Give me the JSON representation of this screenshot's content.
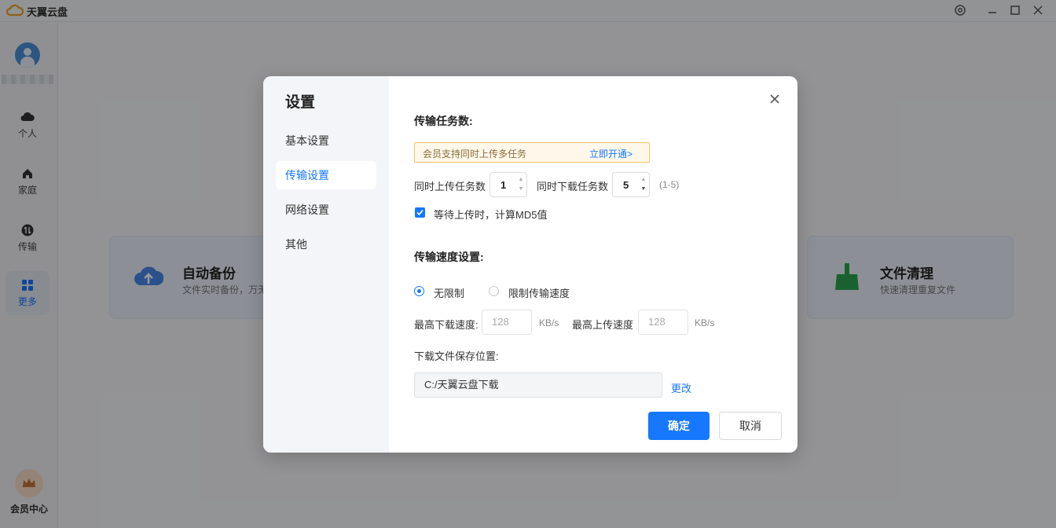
{
  "app": {
    "title": "天翼云盘"
  },
  "sidebar": {
    "items": [
      {
        "label": "个人"
      },
      {
        "label": "家庭"
      },
      {
        "label": "传输"
      },
      {
        "label": "更多"
      }
    ],
    "vip_label": "会员中心"
  },
  "cards": [
    {
      "title": "自动备份",
      "desc": "文件实时备份，万无"
    },
    {
      "title": "文件清理",
      "desc": "快速清理重复文件"
    }
  ],
  "dialog": {
    "title": "设置",
    "menu": [
      "基本设置",
      "传输设置",
      "网络设置",
      "其他"
    ],
    "active_menu": "传输设置",
    "task_section": "传输任务数:",
    "promo": {
      "text": "会员支持同时上传多任务",
      "link": "立即开通>"
    },
    "upload_tasks_label": "同时上传任务数",
    "upload_tasks_value": "1",
    "download_tasks_label": "同时下载任务数",
    "download_tasks_value": "5",
    "tasks_range": "(1-5)",
    "md5_label": "等待上传时，计算MD5值",
    "md5_checked": true,
    "speed_section": "传输速度设置:",
    "speed_options": [
      "无限制",
      "限制传输速度"
    ],
    "speed_selected": "无限制",
    "max_download_label": "最高下载速度:",
    "max_download_value": "128",
    "max_upload_label": "最高上传速度",
    "max_upload_value": "128",
    "unit": "KB/s",
    "save_path_label": "下载文件保存位置:",
    "save_path_value": "C:/天翼云盘下载",
    "change_link": "更改",
    "ok_label": "确定",
    "cancel_label": "取消"
  },
  "colors": {
    "accent": "#1677ff",
    "promo_border": "#f5c26b"
  }
}
